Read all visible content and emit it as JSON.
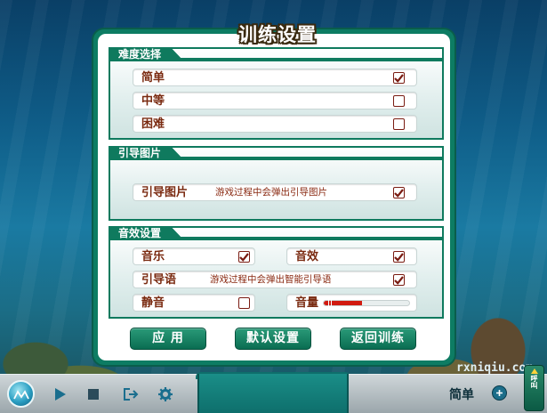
{
  "dialog": {
    "title": "训练设置",
    "sections": {
      "difficulty": {
        "label": "难度选择",
        "options": [
          {
            "label": "简单",
            "checked": true
          },
          {
            "label": "中等",
            "checked": false
          },
          {
            "label": "困难",
            "checked": false
          }
        ]
      },
      "guide": {
        "label": "引导图片",
        "row": {
          "label": "引导图片",
          "desc": "游戏过程中会弹出引导图片",
          "checked": true
        }
      },
      "sound": {
        "label": "音效设置",
        "music": {
          "label": "音乐",
          "checked": true
        },
        "effects": {
          "label": "音效",
          "checked": true
        },
        "voice": {
          "label": "引导语",
          "desc": "游戏过程中会弹出智能引导语",
          "checked": true
        },
        "mute": {
          "label": "静音",
          "checked": false
        },
        "volume": {
          "label": "音量",
          "level": 0.45
        }
      }
    },
    "buttons": {
      "apply": "应  用",
      "defaults": "默认设置",
      "back": "返回训练"
    }
  },
  "toolbar": {
    "level_text": "简单",
    "side_tab": "呼叫"
  },
  "watermark": "rxniqiu.com",
  "colors": {
    "accent": "#0f7a5e",
    "check": "#7a1c12",
    "volume_fill": "#d11a10",
    "title_stroke": "#3a2a10"
  }
}
